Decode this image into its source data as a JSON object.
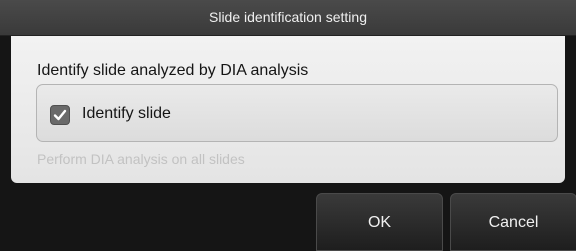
{
  "dialog": {
    "title": "Slide identification setting"
  },
  "section": {
    "label": "Identify slide analyzed by DIA analysis"
  },
  "option": {
    "label": "Identify slide",
    "checked": true,
    "check_icon": "checkmark-icon"
  },
  "hint": {
    "text": "Perform DIA analysis on all slides"
  },
  "buttons": {
    "ok_label": "OK",
    "cancel_label": "Cancel"
  },
  "colors": {
    "title_bar": "#3f3f3f",
    "panel": "#ececec",
    "checkbox_fill": "#6a6a6a",
    "disabled_text": "#c2c2c2"
  }
}
